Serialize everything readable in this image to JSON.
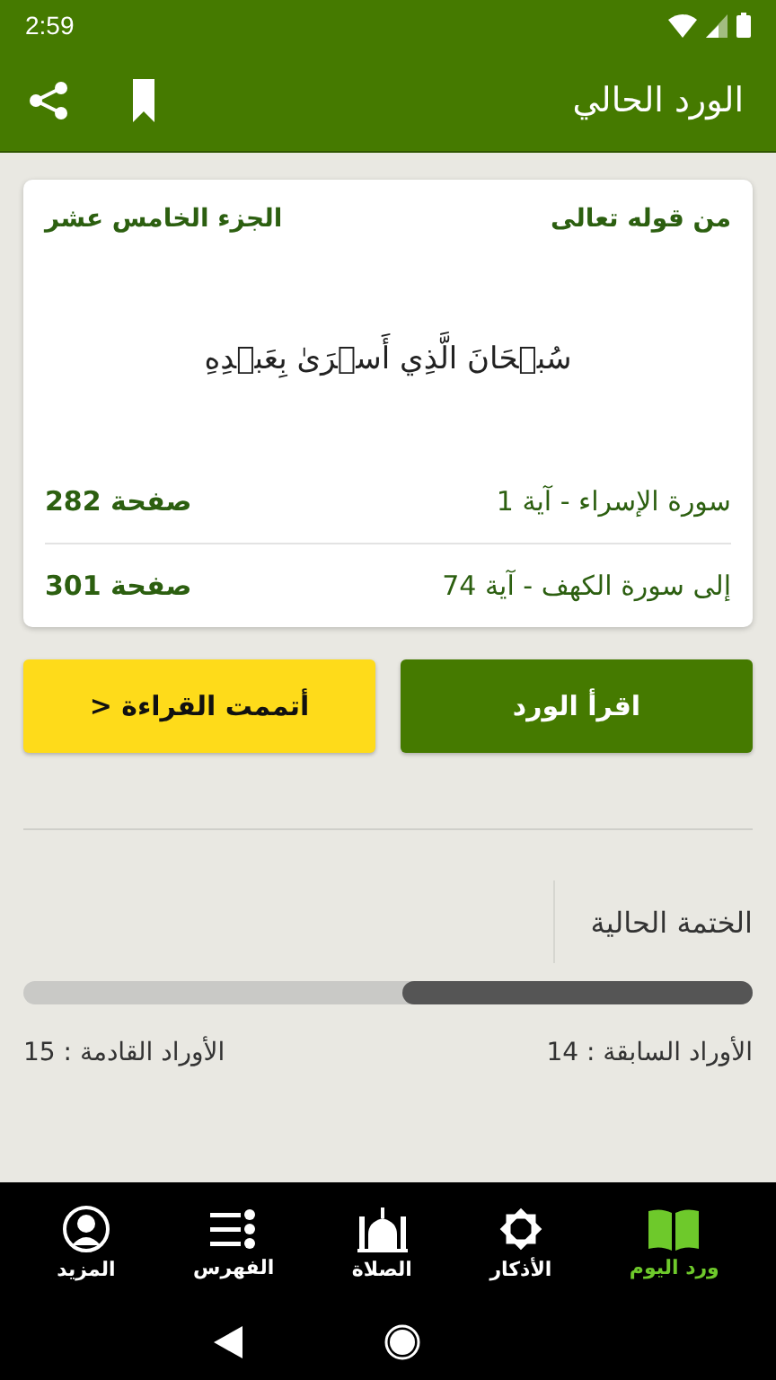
{
  "status_bar": {
    "time": "2:59"
  },
  "app_bar": {
    "title": "الورد الحالي"
  },
  "card": {
    "intro": "من قوله تعالى",
    "juz": "الجزء الخامس عشر",
    "verse": "سُبۡحَانَ الَّذِي أَسۡرَىٰ بِعَبۡدِهِ",
    "rows": [
      {
        "location": "سورة الإسراء - آية 1",
        "page": "صفحة 282"
      },
      {
        "location": "إلى سورة الكهف - آية 74",
        "page": "صفحة 301"
      }
    ]
  },
  "buttons": {
    "read": "اقرأ الورد",
    "done": "أتممت القراءة",
    "done_arrow": "<"
  },
  "khatma": {
    "title": "الختمة الحالية",
    "level": 0.48,
    "previous": "الأوراد السابقة : 14",
    "next": "الأوراد القادمة : 15"
  },
  "bottom_nav": [
    {
      "kind": "book",
      "label": "ورد اليوم",
      "selected": true
    },
    {
      "kind": "star",
      "label": "الأذكار",
      "selected": false
    },
    {
      "kind": "mosque",
      "label": "الصلاة",
      "selected": false
    },
    {
      "kind": "index",
      "label": "الفهرس",
      "selected": false
    },
    {
      "kind": "person",
      "label": "المزيد",
      "selected": false
    }
  ]
}
